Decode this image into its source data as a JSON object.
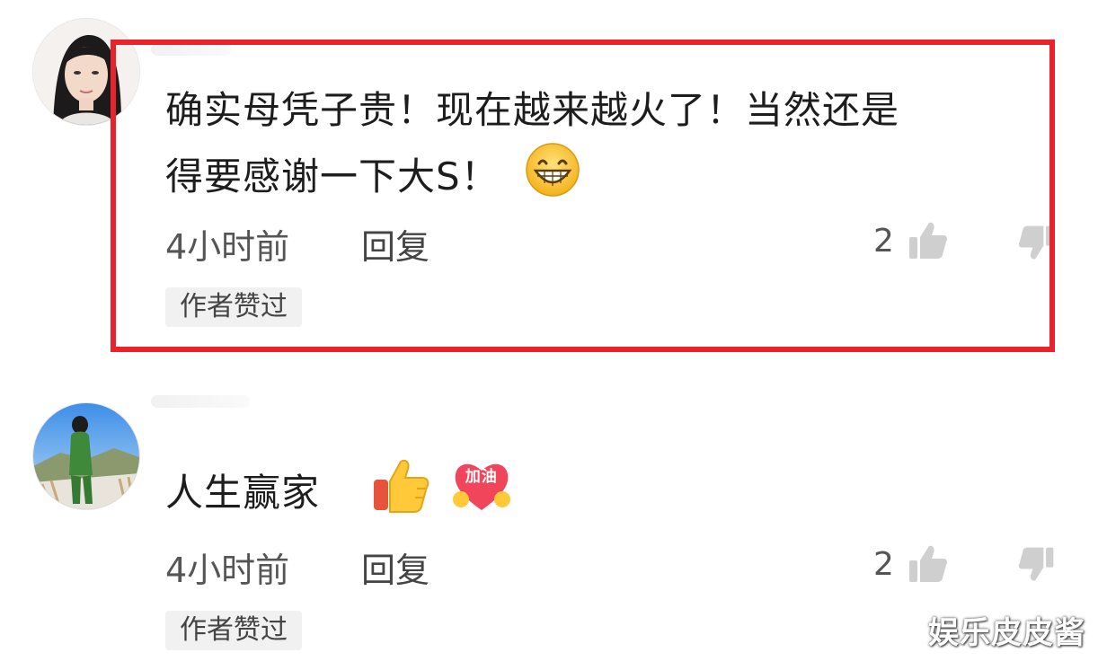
{
  "comments": [
    {
      "text_line1": "确实母凭子贵！现在越来越火了！当然还是",
      "text_line2": "得要感谢一下大S！",
      "emoji": [
        "grin-emoji"
      ],
      "time": "4小时前",
      "reply_label": "回复",
      "likes": "2",
      "badge": "作者赞过",
      "highlighted": true
    },
    {
      "text_line1": "人生赢家",
      "emoji": [
        "thumbs-up-emoji",
        "jiayou-heart-emoji"
      ],
      "emoji_text": "加油",
      "time": "4小时前",
      "reply_label": "回复",
      "likes": "2",
      "badge": "作者赞过",
      "highlighted": false
    }
  ],
  "colors": {
    "highlight_border": "#e8232b",
    "badge_bg": "#f1f1f1"
  },
  "watermark": "娱乐皮皮酱"
}
